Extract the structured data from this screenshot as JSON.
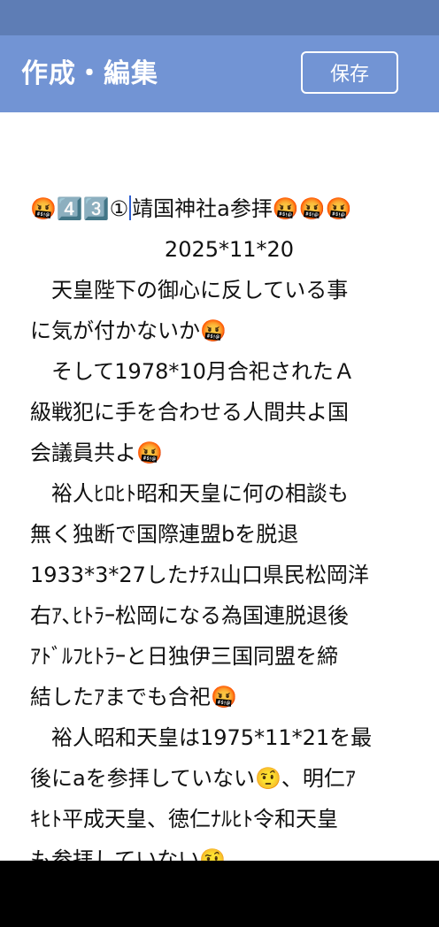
{
  "header": {
    "title": "作成・編集",
    "save_label": "保存"
  },
  "editor": {
    "title_before_caret": "🤬4️⃣3️⃣①",
    "title_after_caret": "靖国神社a参拝🤬🤬🤬",
    "date": "2025*11*20",
    "lines": [
      "　天皇陛下の御心に反している事",
      "に気が付かないか🤬",
      "　そして1978*10月合祀されたＡ",
      "級戦犯に手を合わせる人間共よ国",
      "会議員共よ🤬",
      "　裕人ﾋﾛﾋﾄ昭和天皇に何の相談も",
      "無く独断で国際連盟bを脱退",
      "1933*3*27したﾅﾁｽ山口県民松岡洋",
      "右ｱ､ﾋﾄﾗｰ松岡になる為国連脱退後",
      "ｱﾄﾞﾙﾌﾋﾄﾗｰと日独伊三国同盟を締",
      "結したｱまでも合祀🤬",
      "　裕人昭和天皇は1975*11*21を最",
      "後にaを参拝していない🤨、明仁ｱ",
      "ｷﾋﾄ平成天皇、徳仁ﾅﾙﾋﾄ令和天皇",
      "も参拝していない🤨"
    ]
  }
}
